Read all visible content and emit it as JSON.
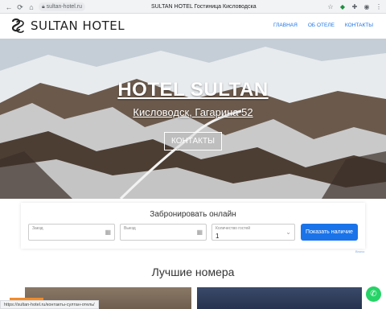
{
  "browser": {
    "url": "sultan-hotel.ru",
    "tab_title": "SULTAN HOTEL Гостиница Кисловодска",
    "icons": [
      "back-arrow-icon",
      "reload-icon",
      "home-icon",
      "lock-icon",
      "star-icon",
      "shield-icon",
      "extension-icon",
      "profile-icon",
      "menu-icon"
    ]
  },
  "header": {
    "logo_text": "SULTAN HOTEL",
    "nav": [
      "ГЛАВНАЯ",
      "ОБ ОТЕЛЕ",
      "КОНТАКТЫ"
    ],
    "accent": "#1a73e8"
  },
  "hero": {
    "title": "HOTEL SULTAN",
    "subtitle": "Кисловодск, Гагарина 52",
    "button": "КОНТАКТЫ"
  },
  "booking": {
    "title": "Забронировать онлайн",
    "checkin_label": "Заезд",
    "checkout_label": "Выезд",
    "guests_label": "Количество гостей",
    "guests_value": "1",
    "submit": "Показать наличие",
    "small_link": "Bnovo"
  },
  "rooms": {
    "title": "Лучшие номера"
  },
  "status": {
    "link_url": "https://sultan-hotel.ru/контакты-султан-отель/"
  }
}
